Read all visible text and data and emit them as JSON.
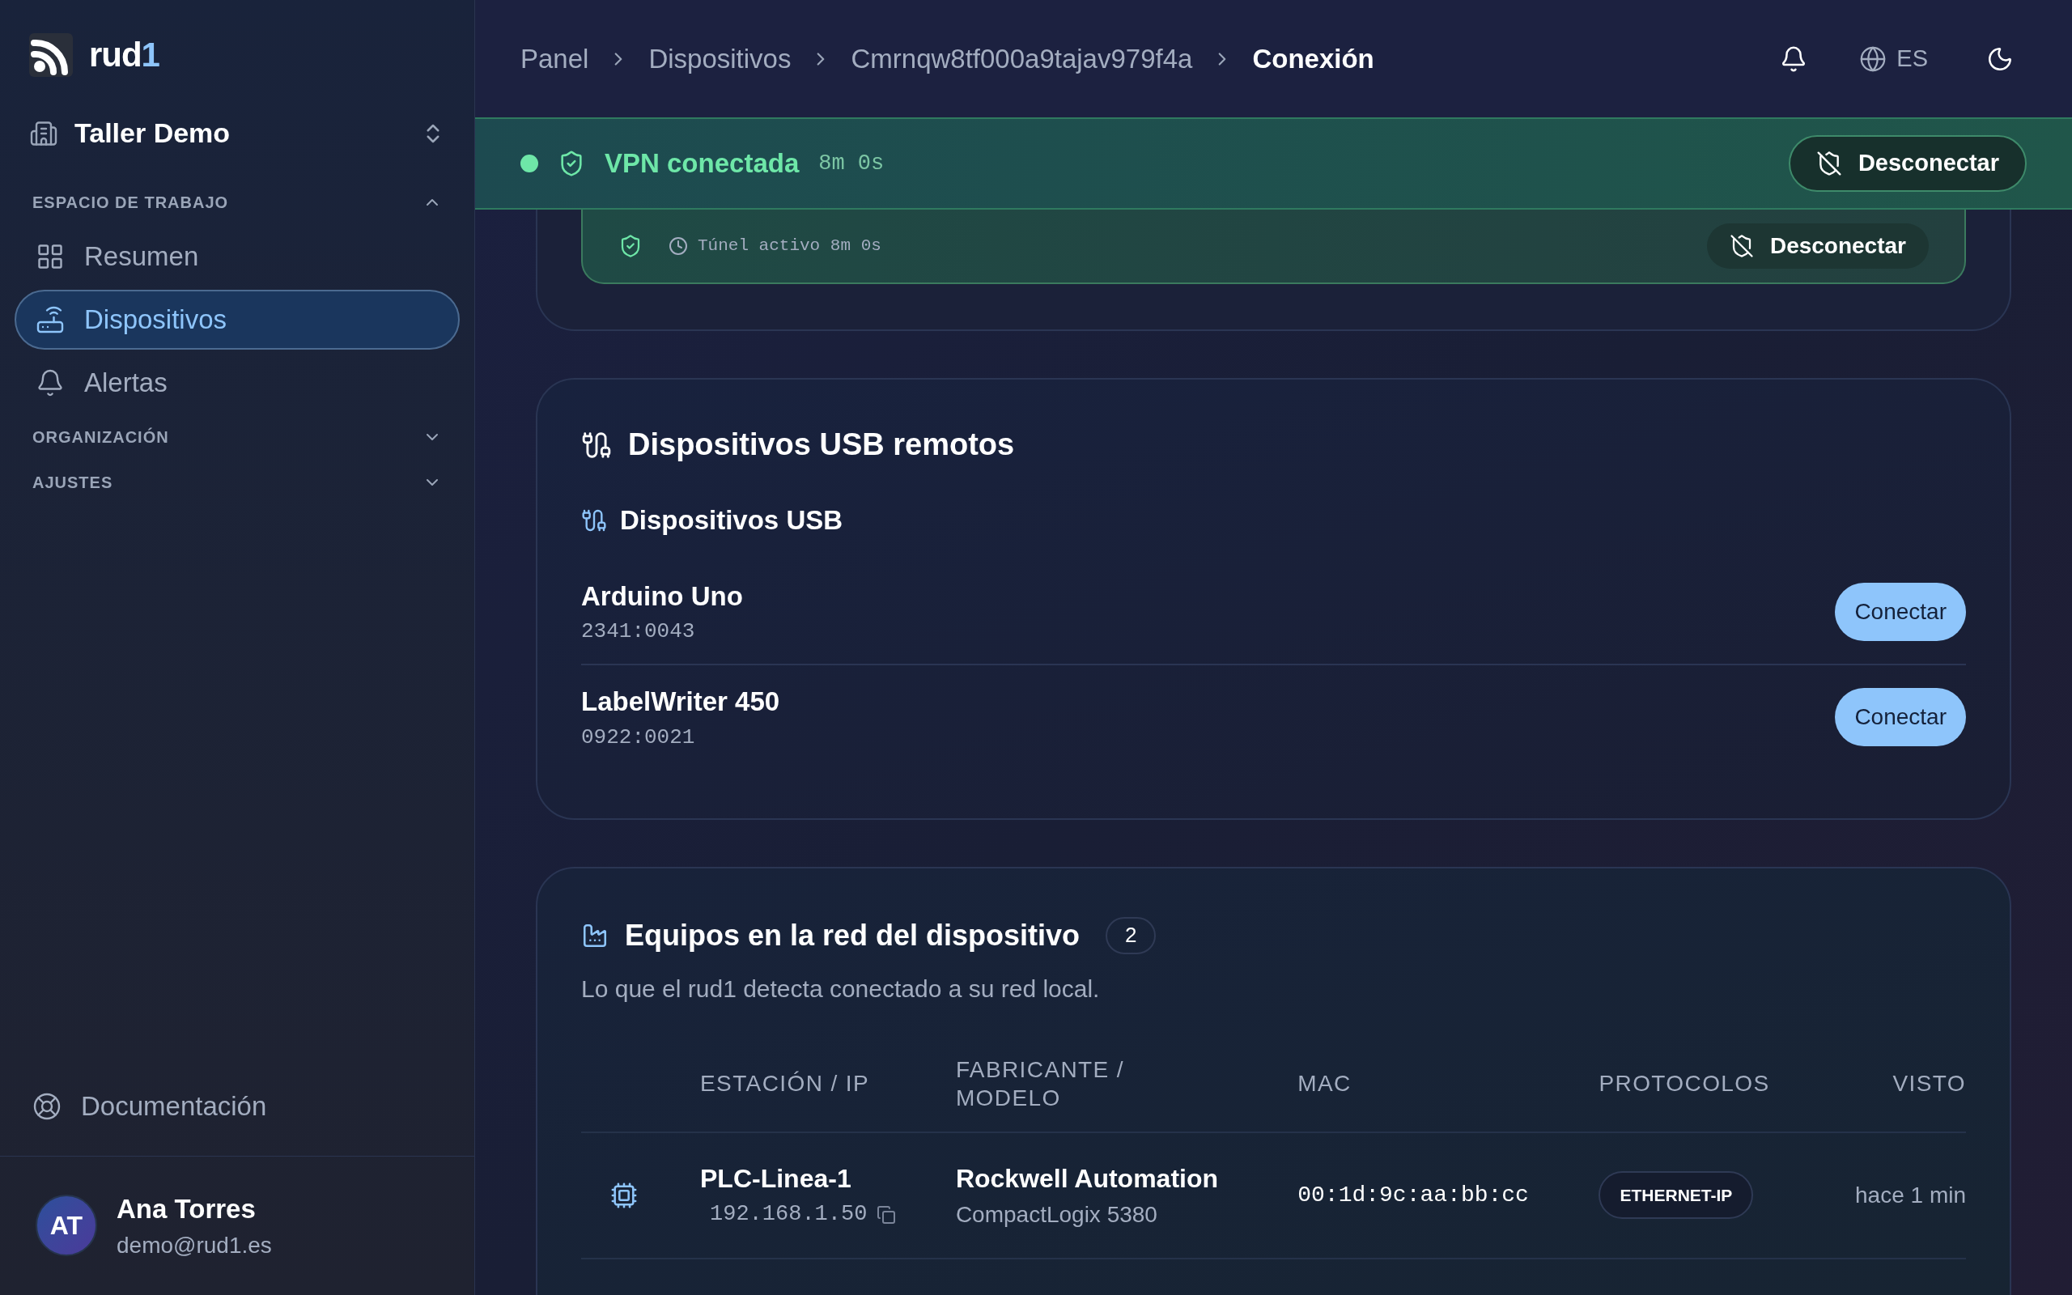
{
  "brand": {
    "name": "rud",
    "accent": "1"
  },
  "workspace": {
    "name": "Taller Demo"
  },
  "nav_sections": [
    {
      "label": "ESPACIO DE TRABAJO",
      "expanded": true,
      "items": [
        {
          "label": "Resumen",
          "selected": false
        },
        {
          "label": "Dispositivos",
          "selected": true
        },
        {
          "label": "Alertas",
          "selected": false
        }
      ]
    },
    {
      "label": "ORGANIZACIÓN",
      "expanded": false
    },
    {
      "label": "AJUSTES",
      "expanded": false
    }
  ],
  "docs_link": "Documentación",
  "user": {
    "initials": "AT",
    "name": "Ana Torres",
    "email": "demo@rud1.es"
  },
  "breadcrumb": [
    "Panel",
    "Dispositivos",
    "Cmrnqw8tf000a9tajav979f4a",
    "Conexión"
  ],
  "header": {
    "language": "ES"
  },
  "vpn_banner": {
    "title": "VPN conectada",
    "duration": "8m 0s",
    "button": "Desconectar"
  },
  "tunnel_card": {
    "status": "Túnel activo 8m 0s",
    "button": "Desconectar"
  },
  "usb_panel": {
    "title": "Dispositivos USB remotos",
    "subtitle": "Dispositivos USB",
    "devices": [
      {
        "name": "Arduino Uno",
        "id": "2341:0043",
        "button": "Conectar"
      },
      {
        "name": "LabelWriter 450",
        "id": "0922:0021",
        "button": "Conectar"
      }
    ]
  },
  "network_panel": {
    "title": "Equipos en la red del dispositivo",
    "count": "2",
    "description": "Lo que el rud1 detecta conectado a su red local.",
    "table": {
      "columns": [
        "ESTACIÓN / IP",
        "FABRICANTE / MODELO",
        "MAC",
        "PROTOCOLOS",
        "VISTO"
      ],
      "rows": [
        {
          "station": "PLC-Linea-1",
          "ip": "192.168.1.50",
          "vendor": "Rockwell Automation",
          "model": "CompactLogix 5380",
          "mac": "00:1d:9c:aa:bb:cc",
          "protocols": [
            "ETHERNET-IP"
          ],
          "seen": "hace 1 min"
        }
      ]
    }
  }
}
